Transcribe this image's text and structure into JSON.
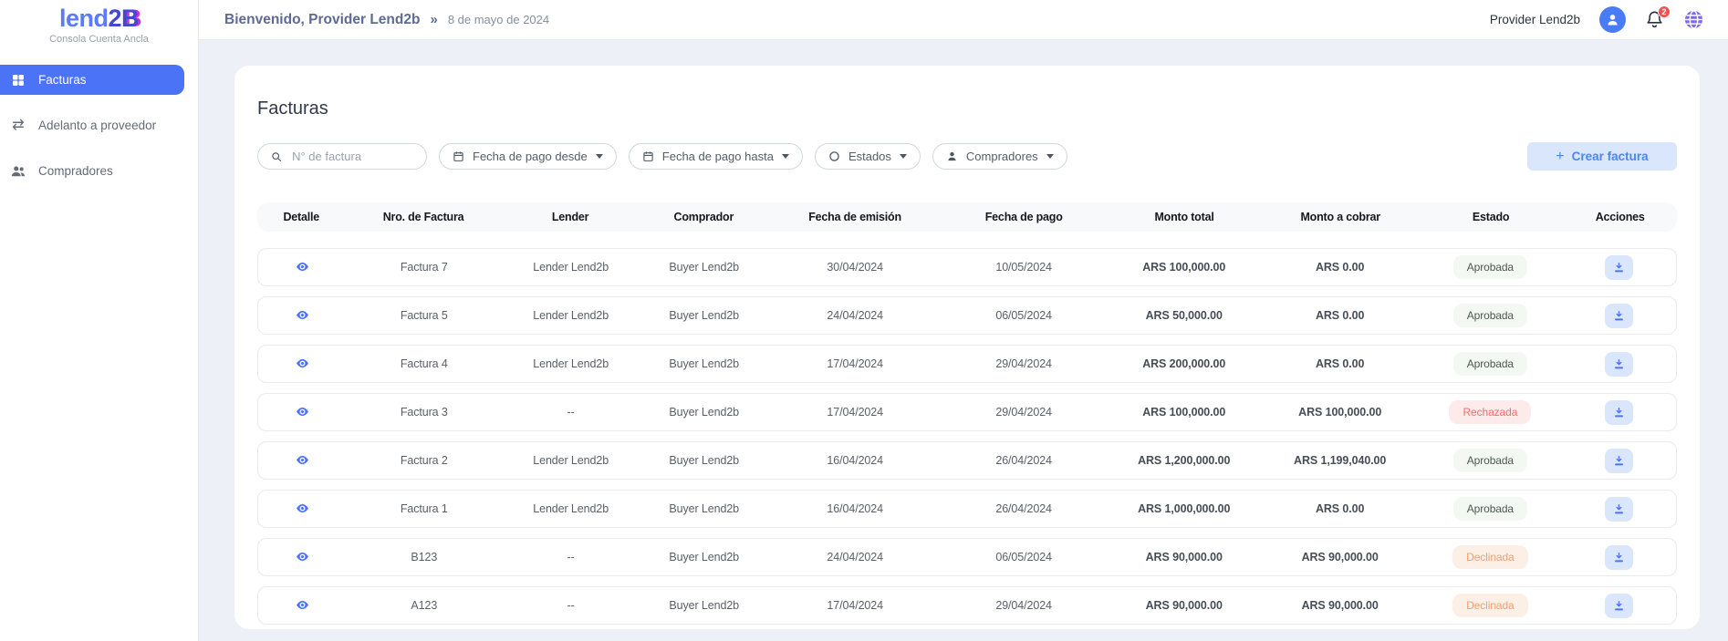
{
  "brand": {
    "logo_lend": "lend",
    "logo_2": "2",
    "logo_b": "B",
    "subtitle": "Consola Cuenta Ancla"
  },
  "topbar": {
    "welcome": "Bienvenido, Provider Lend2b",
    "separator": "»",
    "date": "8 de mayo de 2024",
    "user_name": "Provider Lend2b",
    "notification_count": "2"
  },
  "sidebar": {
    "items": [
      {
        "label": "Facturas",
        "icon": "grid-icon",
        "active": true
      },
      {
        "label": "Adelanto a proveedor",
        "icon": "transfer-arrows-icon",
        "active": false
      },
      {
        "label": "Compradores",
        "icon": "people-icon",
        "active": false
      }
    ]
  },
  "page": {
    "title": "Facturas"
  },
  "filters": {
    "search_placeholder": "N° de factura",
    "date_from_label": "Fecha de pago desde",
    "date_to_label": "Fecha de pago hasta",
    "states_label": "Estados",
    "buyers_label": "Compradores",
    "create_label": "Crear factura",
    "plus": "+"
  },
  "table": {
    "headers": [
      "Detalle",
      "Nro. de Factura",
      "Lender",
      "Comprador",
      "Fecha de emisión",
      "Fecha de pago",
      "Monto total",
      "Monto a cobrar",
      "Estado",
      "Acciones"
    ],
    "rows": [
      {
        "nro": "Factura 7",
        "lender": "Lender Lend2b",
        "comprador": "Buyer Lend2b",
        "fecha_emision": "30/04/2024",
        "fecha_pago": "10/05/2024",
        "monto_total": "ARS 100,000.00",
        "monto_a_cobrar": "ARS 0.00",
        "estado": "Aprobada",
        "estado_type": "approved"
      },
      {
        "nro": "Factura 5",
        "lender": "Lender Lend2b",
        "comprador": "Buyer Lend2b",
        "fecha_emision": "24/04/2024",
        "fecha_pago": "06/05/2024",
        "monto_total": "ARS 50,000.00",
        "monto_a_cobrar": "ARS 0.00",
        "estado": "Aprobada",
        "estado_type": "approved"
      },
      {
        "nro": "Factura 4",
        "lender": "Lender Lend2b",
        "comprador": "Buyer Lend2b",
        "fecha_emision": "17/04/2024",
        "fecha_pago": "29/04/2024",
        "monto_total": "ARS 200,000.00",
        "monto_a_cobrar": "ARS 0.00",
        "estado": "Aprobada",
        "estado_type": "approved"
      },
      {
        "nro": "Factura 3",
        "lender": "--",
        "comprador": "Buyer Lend2b",
        "fecha_emision": "17/04/2024",
        "fecha_pago": "29/04/2024",
        "monto_total": "ARS 100,000.00",
        "monto_a_cobrar": "ARS 100,000.00",
        "estado": "Rechazada",
        "estado_type": "rejected"
      },
      {
        "nro": "Factura 2",
        "lender": "Lender Lend2b",
        "comprador": "Buyer Lend2b",
        "fecha_emision": "16/04/2024",
        "fecha_pago": "26/04/2024",
        "monto_total": "ARS 1,200,000.00",
        "monto_a_cobrar": "ARS 1,199,040.00",
        "estado": "Aprobada",
        "estado_type": "approved"
      },
      {
        "nro": "Factura 1",
        "lender": "Lender Lend2b",
        "comprador": "Buyer Lend2b",
        "fecha_emision": "16/04/2024",
        "fecha_pago": "26/04/2024",
        "monto_total": "ARS 1,000,000.00",
        "monto_a_cobrar": "ARS 0.00",
        "estado": "Aprobada",
        "estado_type": "approved"
      },
      {
        "nro": "B123",
        "lender": "--",
        "comprador": "Buyer Lend2b",
        "fecha_emision": "24/04/2024",
        "fecha_pago": "06/05/2024",
        "monto_total": "ARS 90,000.00",
        "monto_a_cobrar": "ARS 90,000.00",
        "estado": "Declinada",
        "estado_type": "declined"
      },
      {
        "nro": "A123",
        "lender": "--",
        "comprador": "Buyer Lend2b",
        "fecha_emision": "17/04/2024",
        "fecha_pago": "29/04/2024",
        "monto_total": "ARS 90,000.00",
        "monto_a_cobrar": "ARS 90,000.00",
        "estado": "Declinada",
        "estado_type": "declined"
      }
    ]
  },
  "colors": {
    "accent_blue": "#4a74f5",
    "logo_blue": "#5b7cfa",
    "logo_indigo": "#4547cf",
    "logo_magenta": "#cc2fd4",
    "badge_approved_bg": "#f3f8f2",
    "badge_rejected_text": "#f26d6d",
    "badge_declined_text": "#efa077",
    "notification_red": "#f05252",
    "globe_purple": "#7a68ee"
  }
}
